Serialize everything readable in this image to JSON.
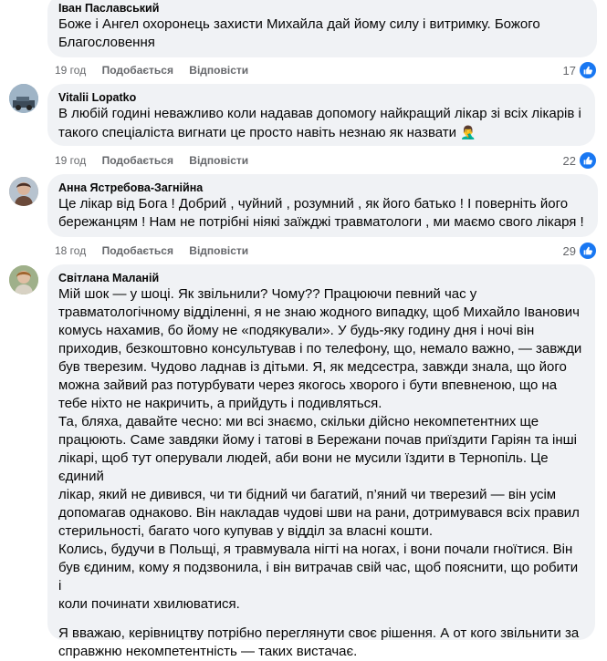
{
  "comments": [
    {
      "author": "Іван Паславський",
      "lines": [
        "Боже і Ангел охоронець захисти Михайла дай йому силу і витримку. Божого",
        "Благословення"
      ],
      "time": "19 год",
      "like_label": "Подобається",
      "reply_label": "Відповісти",
      "reactions": "17"
    },
    {
      "author": "Vitalii Lopatko",
      "lines": [
        "В любій годині неважливо коли надавав допомогу найкращий лікар зі всіх лікарів і",
        "такого спеціаліста вигнати це просто навіть незнаю як назвати"
      ],
      "emoji": "🤦‍♂️",
      "time": "19 год",
      "like_label": "Подобається",
      "reply_label": "Відповісти",
      "reactions": "22"
    },
    {
      "author": "Анна Ястребова-Загнійна",
      "lines": [
        "Це лікар від Бога ! Добрий , чуйний , розумний , як його батько ! І поверніть його",
        "бережанцям ! Нам не потрібні ніякі заїжджі травматологи , ми маємо свого лікаря !"
      ],
      "time": "18 год",
      "like_label": "Подобається",
      "reply_label": "Відповісти",
      "reactions": "29"
    },
    {
      "author": "Світлана Маланій",
      "paragraphs": [
        [
          "Мій шок — у шоці. Як звільнили? Чому?? Працюючи певний час у",
          "травматологічному відділенні, я не знаю жодного випадку, щоб Михайло Іванович",
          "комусь нахамив, бо йому не «подякували». У будь-яку годину дня і ночі він",
          "приходив, безкоштовно консультував і по телефону, що, немало важно, — завжди",
          "був тверезим. Чудово ладнав із дітьми. Я, як медсестра, завжди знала, що його",
          "можна зайвий раз потурбувати через якогось хворого і бути впевненою, що на",
          "тебе ніхто не накричить, а прийдуть і подивляться."
        ],
        [
          "Та, бляха, давайте чесно: ми всі знаємо, скільки дійсно некомпетентних ще",
          "працюють. Саме завдяки йому і татові в Бережани почав приїздити Гаріян та інші",
          "лікарі, щоб тут оперували людей, аби вони не мусили їздити в Тернопіль. Це єдиний",
          "лікар, який не дивився, чи ти бідний чи багатий, п’яний чи тверезий — він усім",
          "допомагав однаково. Він накладав чудові шви на рани, дотримувався всіх правил",
          "стерильності, багато чого купував у відділ за власні кошти."
        ],
        [
          "Колись, будучи в Польщі, я травмувала нігті на ногах, і вони почали гноїтися. Він",
          "був єдиним, кому я подзвонила, і він витрачав свій час, щоб пояснити, що робити і",
          "коли починати хвилюватися."
        ],
        [
          "Я вважаю, керівництву потрібно переглянути своє рішення. А от кого звільнити за",
          "справжню некомпетентність — таких вистачає."
        ]
      ]
    }
  ]
}
